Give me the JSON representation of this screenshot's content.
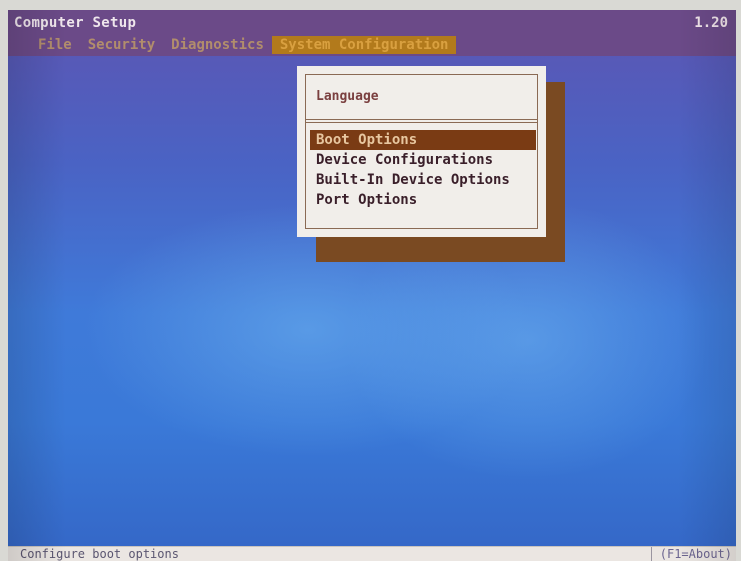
{
  "app": {
    "title": "Computer Setup",
    "version": "1.20"
  },
  "menu": {
    "items": [
      {
        "label": "File"
      },
      {
        "label": "Security"
      },
      {
        "label": "Diagnostics"
      },
      {
        "label": "System Configuration",
        "active": true
      }
    ]
  },
  "dropdown": {
    "header_item": "Language",
    "options": [
      {
        "label": "Boot Options",
        "selected": true
      },
      {
        "label": "Device Configurations"
      },
      {
        "label": "Built-In Device Options"
      },
      {
        "label": "Port Options"
      }
    ]
  },
  "status": {
    "text": "Configure boot options",
    "help": "(F1=About)"
  },
  "colors": {
    "background": "#3f7ad9",
    "title_bar": "#6b4a88",
    "active_menu": "#b27a1c",
    "selection": "#7a3b14",
    "menu_panel": "#f1eeea"
  }
}
